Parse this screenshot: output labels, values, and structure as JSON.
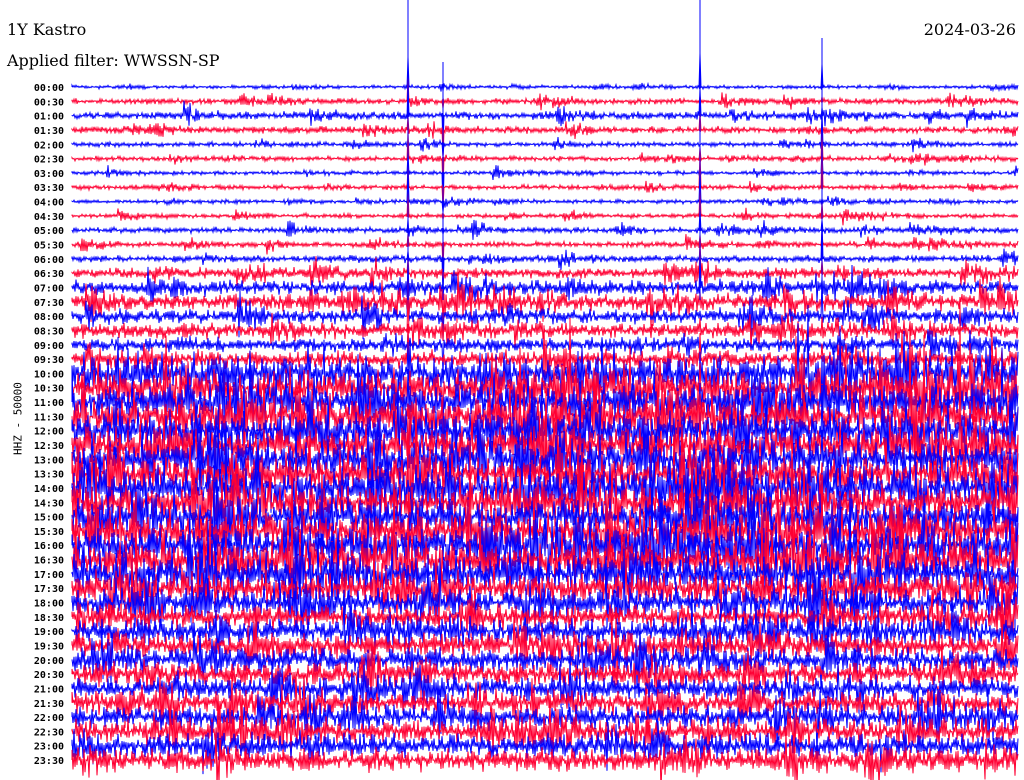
{
  "header": {
    "station": "1Y Kastro",
    "date": "2024-03-26",
    "filter": "Applied filter: WWSSN-SP"
  },
  "chart_data": {
    "type": "line",
    "title": "1Y Kastro",
    "subtitle": "Applied filter: WWSSN-SP",
    "ylabel": "HHZ - 50000",
    "xlabel": "",
    "row_labels": [
      "00:00",
      "00:30",
      "01:00",
      "01:30",
      "02:00",
      "02:30",
      "03:00",
      "03:30",
      "04:00",
      "04:30",
      "05:00",
      "05:30",
      "06:00",
      "06:30",
      "07:00",
      "07:30",
      "08:00",
      "08:30",
      "09:00",
      "09:30",
      "10:00",
      "10:30",
      "11:00",
      "11:30",
      "12:00",
      "12:30",
      "13:00",
      "13:30",
      "14:00",
      "14:30",
      "15:00",
      "15:30",
      "16:00",
      "16:30",
      "17:00",
      "17:30",
      "18:00",
      "18:30",
      "19:00",
      "19:30",
      "20:00",
      "20:30",
      "21:00",
      "21:30",
      "22:00",
      "22:30",
      "23:00",
      "23:30"
    ],
    "row_relative_amplitude": [
      0.3,
      0.5,
      0.7,
      0.6,
      0.4,
      0.4,
      0.35,
      0.4,
      0.35,
      0.4,
      0.5,
      0.5,
      0.6,
      0.9,
      1.2,
      1.4,
      1.3,
      1.3,
      1.2,
      1.5,
      3,
      3,
      3,
      3,
      3,
      3,
      3,
      3,
      3,
      3,
      3,
      3,
      3,
      3,
      3,
      2.5,
      2.2,
      2,
      2,
      2,
      2,
      2,
      2,
      2,
      2,
      2,
      2,
      2
    ],
    "series_colors": [
      "#0000ff",
      "#ff0033"
    ],
    "grid": false
  }
}
